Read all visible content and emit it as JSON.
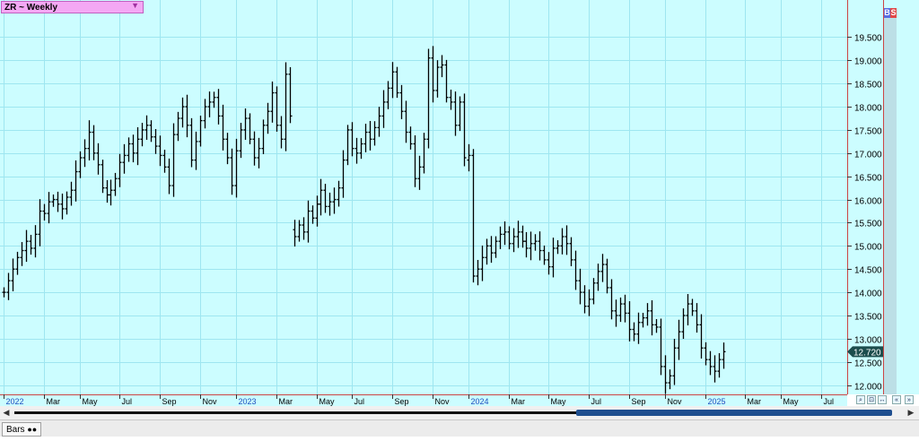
{
  "symbol": {
    "label": "ZR ~ Weekly",
    "dropdown_icon": "triangle-down-icon"
  },
  "bs_labels": {
    "b": "B",
    "s": "S"
  },
  "bottom": {
    "tab_label": "Bars",
    "tab_icon": "double-dot-icon"
  },
  "colors": {
    "background": "#ccfdff",
    "grid": "#9ee6f0",
    "bar": "#000000",
    "price_tag_bg": "#1c4d4d",
    "axis_border": "#cc4444"
  },
  "chart_data": {
    "type": "ohlc",
    "price_axis": {
      "ticks": [
        "12.000",
        "12.500",
        "13.000",
        "13.500",
        "14.000",
        "14.500",
        "15.000",
        "15.500",
        "16.000",
        "16.500",
        "17.000",
        "17.500",
        "18.000",
        "18.500",
        "19.000",
        "19.500"
      ],
      "range": [
        11.8,
        20.3
      ],
      "last_price": "12.720"
    },
    "time_axis": {
      "labels": [
        "2022",
        "Mar",
        "May",
        "Jul",
        "Sep",
        "Nov",
        "2023",
        "Mar",
        "May",
        "Jul",
        "Sep",
        "Nov",
        "2024",
        "Mar",
        "May",
        "Jul",
        "Sep",
        "Nov",
        "2025",
        "Mar",
        "May",
        "Jul"
      ],
      "year_labels": [
        "2022",
        "2023",
        "2024",
        "2025"
      ],
      "label_weeks": [
        0,
        9,
        17,
        26,
        35,
        44,
        52,
        61,
        70,
        78,
        87,
        96,
        104,
        113,
        122,
        131,
        140,
        148,
        157,
        166,
        174,
        183
      ],
      "weeks_total": 188
    },
    "closes": [
      14.0,
      14.25,
      14.5,
      14.75,
      14.9,
      15.1,
      14.95,
      15.25,
      15.75,
      15.7,
      15.95,
      16.0,
      15.9,
      15.8,
      16.05,
      16.2,
      16.6,
      16.9,
      17.1,
      17.45,
      17.0,
      16.75,
      16.25,
      16.1,
      16.2,
      16.45,
      16.8,
      16.95,
      17.2,
      17.0,
      17.3,
      17.5,
      17.6,
      17.35,
      17.15,
      16.95,
      16.7,
      16.3,
      17.4,
      17.75,
      18.0,
      17.6,
      16.85,
      17.25,
      17.7,
      18.0,
      18.1,
      18.2,
      17.8,
      17.3,
      16.9,
      16.3,
      17.05,
      17.5,
      17.75,
      17.3,
      16.9,
      17.1,
      17.6,
      17.9,
      18.3,
      17.6,
      17.3,
      18.7,
      17.8,
      15.2,
      15.45,
      15.3,
      15.75,
      15.6,
      15.9,
      16.2,
      15.85,
      15.95,
      16.0,
      16.25,
      16.85,
      17.5,
      17.1,
      17.0,
      17.2,
      17.45,
      17.3,
      17.55,
      17.8,
      18.1,
      18.4,
      18.75,
      18.3,
      17.9,
      17.45,
      17.2,
      16.45,
      16.7,
      17.3,
      19.05,
      18.35,
      18.85,
      18.9,
      18.2,
      18.1,
      17.6,
      18.1,
      16.9,
      16.95,
      14.35,
      14.5,
      14.75,
      15.0,
      14.85,
      15.1,
      15.25,
      15.3,
      15.05,
      15.2,
      15.3,
      15.1,
      14.95,
      15.05,
      15.1,
      14.9,
      14.7,
      14.55,
      14.95,
      15.0,
      15.2,
      15.05,
      14.7,
      14.25,
      14.0,
      13.7,
      13.85,
      14.2,
      14.45,
      14.6,
      14.1,
      13.6,
      13.5,
      13.75,
      13.55,
      13.2,
      13.1,
      13.35,
      13.45,
      13.6,
      13.3,
      13.25,
      12.4,
      12.05,
      12.2,
      12.8,
      13.15,
      13.5,
      13.75,
      13.6,
      13.3,
      12.8,
      12.55,
      12.4,
      12.3,
      12.55,
      12.72
    ],
    "open_first": 14.0,
    "gaps": [
      65,
      104
    ]
  }
}
